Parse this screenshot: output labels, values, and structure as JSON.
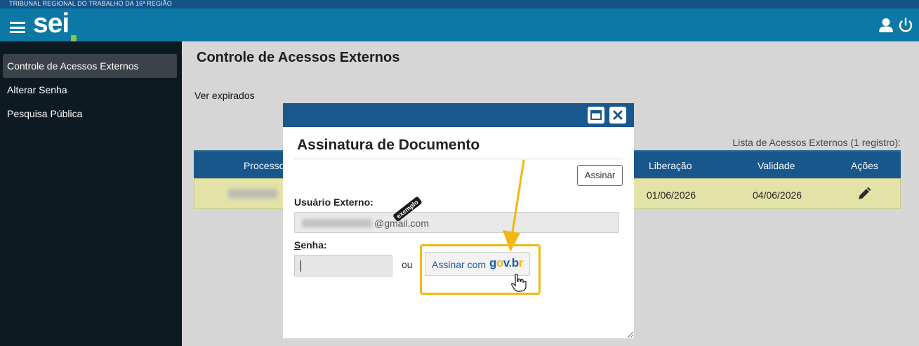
{
  "app": {
    "org_name": "TRIBUNAL REGIONAL DO TRABALHO DA 16ª REGIÃO",
    "logo_text": "sei",
    "header_colors": {
      "strip": "#155387",
      "bar": "#0c78a5",
      "logo_accent": "#88c541"
    }
  },
  "sidebar": {
    "items": [
      {
        "label": "Controle de Acessos Externos",
        "active": true
      },
      {
        "label": "Alterar Senha"
      },
      {
        "label": "Pesquisa Pública"
      }
    ]
  },
  "main": {
    "title": "Controle de Acessos Externos",
    "ver_expirados": "Ver expirados",
    "list_caption": "Lista de Acessos Externos (1 registro):",
    "table": {
      "headers": [
        "Processo",
        "Liberação",
        "Validade",
        "Ações"
      ],
      "rows": [
        {
          "processo": "",
          "liberacao": "01/06/2026",
          "validade": "04/06/2026",
          "action_icon": "pencil-icon"
        }
      ]
    }
  },
  "modal": {
    "title": "Assinatura de Documento",
    "assinar_label": "Assinar",
    "usuario_label": "Usuário Externo:",
    "usuario_visible_suffix": "@gmail.com",
    "exemplo_tag": "exemplo",
    "senha_label": "Senha:",
    "senha_value": "",
    "ou_label": "ou",
    "govbr_text": "Assinar com",
    "govbr_brand": {
      "g": "g",
      "o": "o",
      "v": "v",
      "dot": ".",
      "b": "b",
      "r": "r"
    },
    "highlight_color": "#f2b811"
  }
}
